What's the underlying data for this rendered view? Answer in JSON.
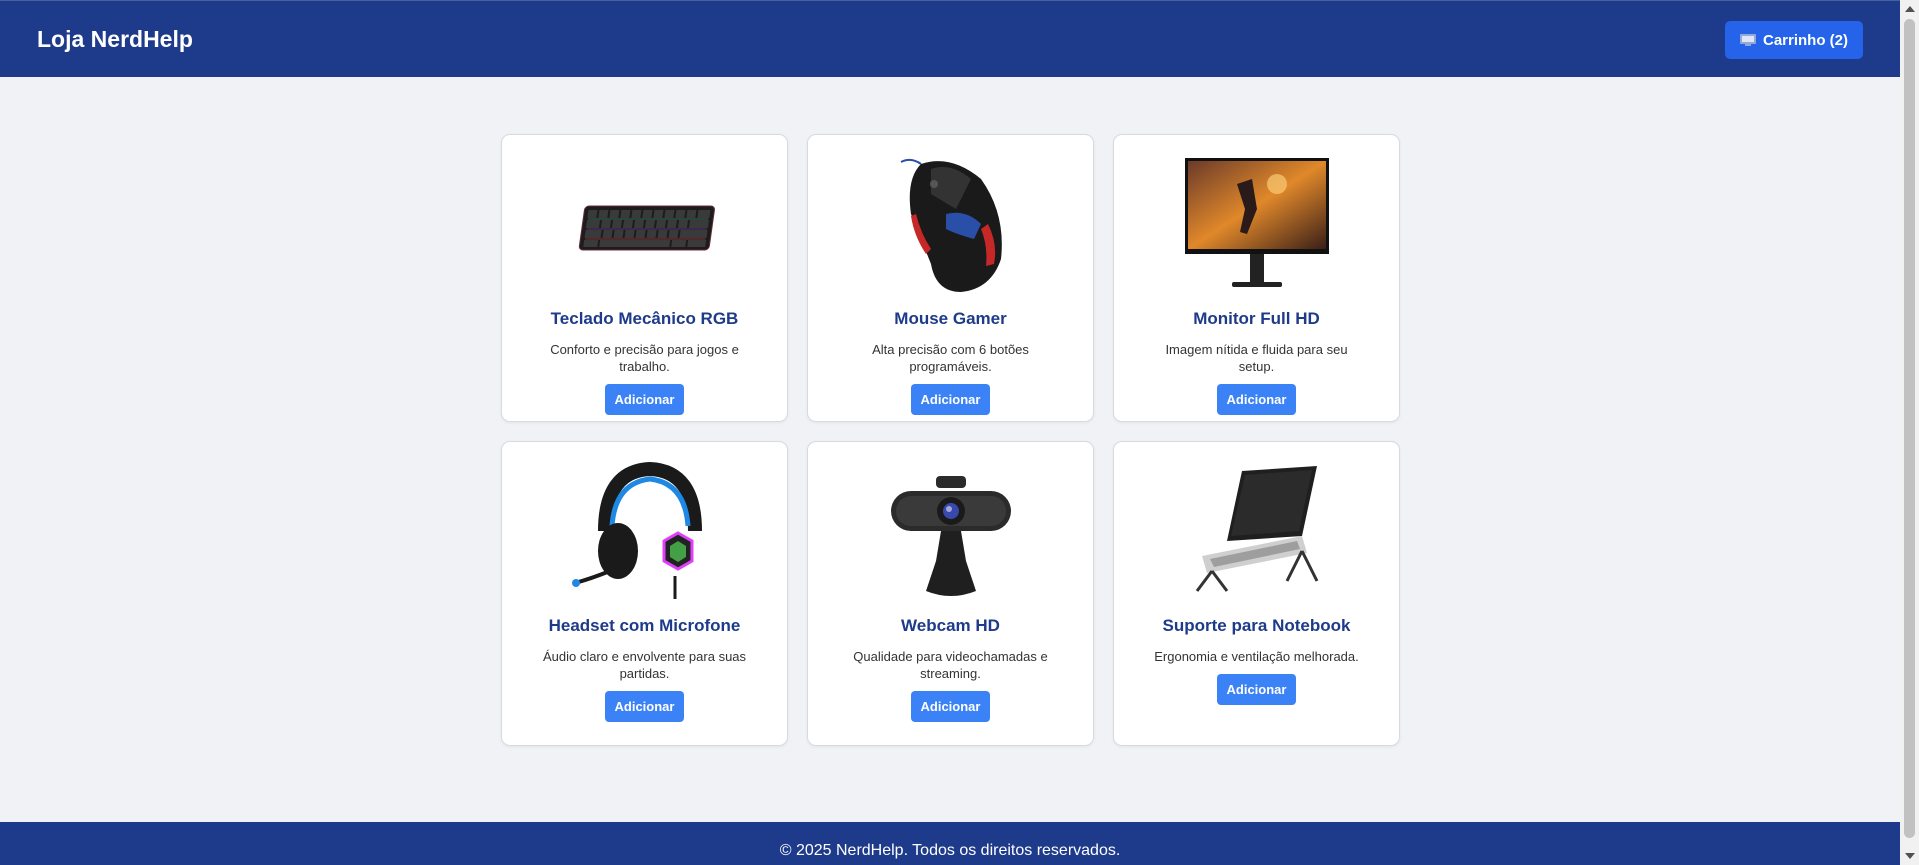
{
  "header": {
    "brand": "Loja NerdHelp",
    "cart_label": "Carrinho (2)",
    "cart_icon": "cart-icon"
  },
  "products": [
    {
      "name": "Teclado Mecânico RGB",
      "description": "Conforto e precisão para jogos e trabalho.",
      "button": "Adicionar",
      "image": "keyboard-image"
    },
    {
      "name": "Mouse Gamer",
      "description": "Alta precisão com 6 botões programáveis.",
      "button": "Adicionar",
      "image": "mouse-image"
    },
    {
      "name": "Monitor Full HD",
      "description": "Imagem nítida e fluida para seu setup.",
      "button": "Adicionar",
      "image": "monitor-image"
    },
    {
      "name": "Headset com Microfone",
      "description": "Áudio claro e envolvente para suas partidas.",
      "button": "Adicionar",
      "image": "headset-image"
    },
    {
      "name": "Webcam HD",
      "description": "Qualidade para videochamadas e streaming.",
      "button": "Adicionar",
      "image": "webcam-image"
    },
    {
      "name": "Suporte para Notebook",
      "description": "Ergonomia e ventilação melhorada.",
      "button": "Adicionar",
      "image": "laptop-stand-image"
    }
  ],
  "footer": {
    "text": "© 2025 NerdHelp. Todos os direitos reservados."
  },
  "colors": {
    "header_bg": "#1e3a8a",
    "accent": "#3b82f6",
    "page_bg": "#f0f2f5"
  }
}
